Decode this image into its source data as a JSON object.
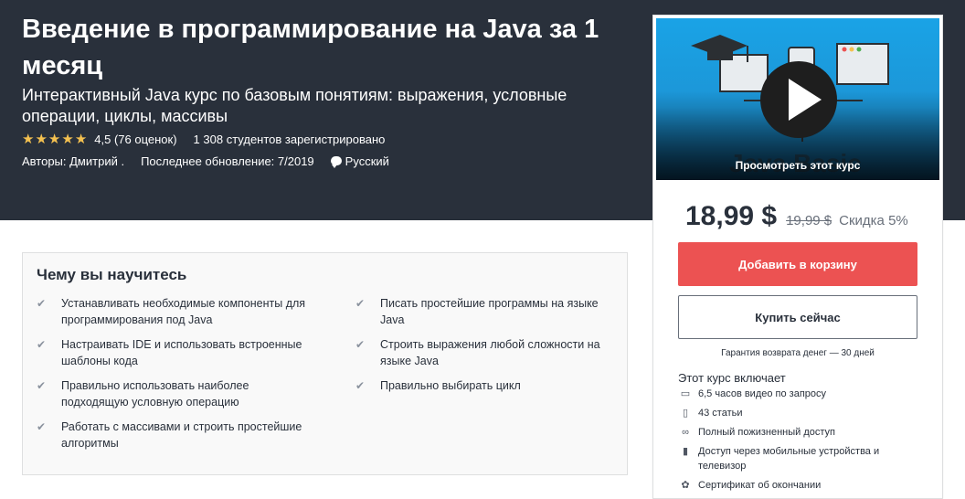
{
  "header": {
    "title": "Введение в программирование на Java за 1 месяц",
    "subtitle": "Интерактивный Java курс по базовым понятиям: выражения, условные операции, циклы, массивы",
    "rating": "4,5 (76 оценок)",
    "rating_value": 4.5,
    "students": "1 308 студентов зарегистрировано",
    "authors": "Авторы: Дмитрий .",
    "updated": "Последнее обновление: 7/2019",
    "language": "Русский"
  },
  "sidebar": {
    "preview_label": "Просмотреть этот курс",
    "price": "18,99 $",
    "old_price": "19,99 $",
    "discount": "Скидка 5%",
    "add_to_cart": "Добавить в корзину",
    "buy_now": "Купить сейчас",
    "guarantee": "Гарантия возврата денег — 30 дней",
    "includes_title": "Этот курс включает",
    "includes": [
      {
        "icon": "video-icon",
        "text": "6,5 часов видео по запросу"
      },
      {
        "icon": "file-icon",
        "text": "43 статьи"
      },
      {
        "icon": "infinity-icon",
        "text": "Полный пожизненный доступ"
      },
      {
        "icon": "mobile-icon",
        "text": "Доступ через мобильные устройства и телевизор"
      },
      {
        "icon": "certificate-icon",
        "text": "Сертификат об окончании"
      }
    ]
  },
  "learn": {
    "title": "Чему вы научитесь",
    "left": [
      "Устанавливать необходимые компоненты для программирования под Java",
      "Настраивать IDE и использовать встроенные шаблоны кода",
      "Правильно использовать наиболее подходящую условную операцию",
      "Работать с массивами и строить простейшие алгоритмы"
    ],
    "right": [
      "Писать простейшие программы на языке Java",
      "Строить выражения любой сложности на языке Java",
      "Правильно выбирать цикл"
    ]
  },
  "colors": {
    "hero_bg": "#29303b",
    "accent_red": "#ec5252",
    "star": "#f4c150"
  }
}
